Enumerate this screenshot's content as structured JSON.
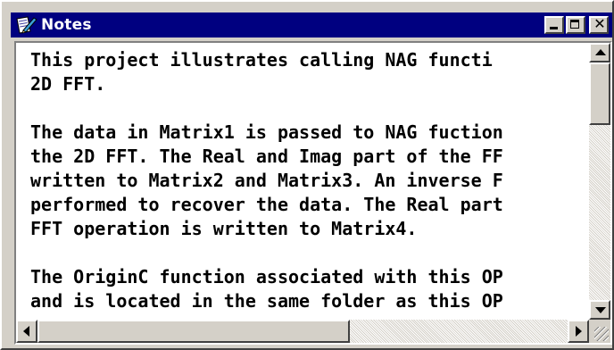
{
  "window": {
    "title": "Notes",
    "icon": "notes-icon"
  },
  "controls": {
    "minimize_icon": "minimize-icon",
    "maximize_icon": "maximize-icon",
    "close_icon": "close-icon"
  },
  "content": {
    "text": "This project illustrates calling NAG functi\n2D FFT.\n\nThe data in Matrix1 is passed to NAG fuction\nthe 2D FFT. The Real and Imag part of the FF\nwritten to Matrix2 and Matrix3. An inverse F\nperformed to recover the data. The Real part\nFFT operation is written to Matrix4.\n\nThe OriginC function associated with this OP\nand is located in the same folder as this OP"
  },
  "colors": {
    "titlebar": "#000080",
    "face": "#d4d0c8",
    "text": "#000000"
  }
}
